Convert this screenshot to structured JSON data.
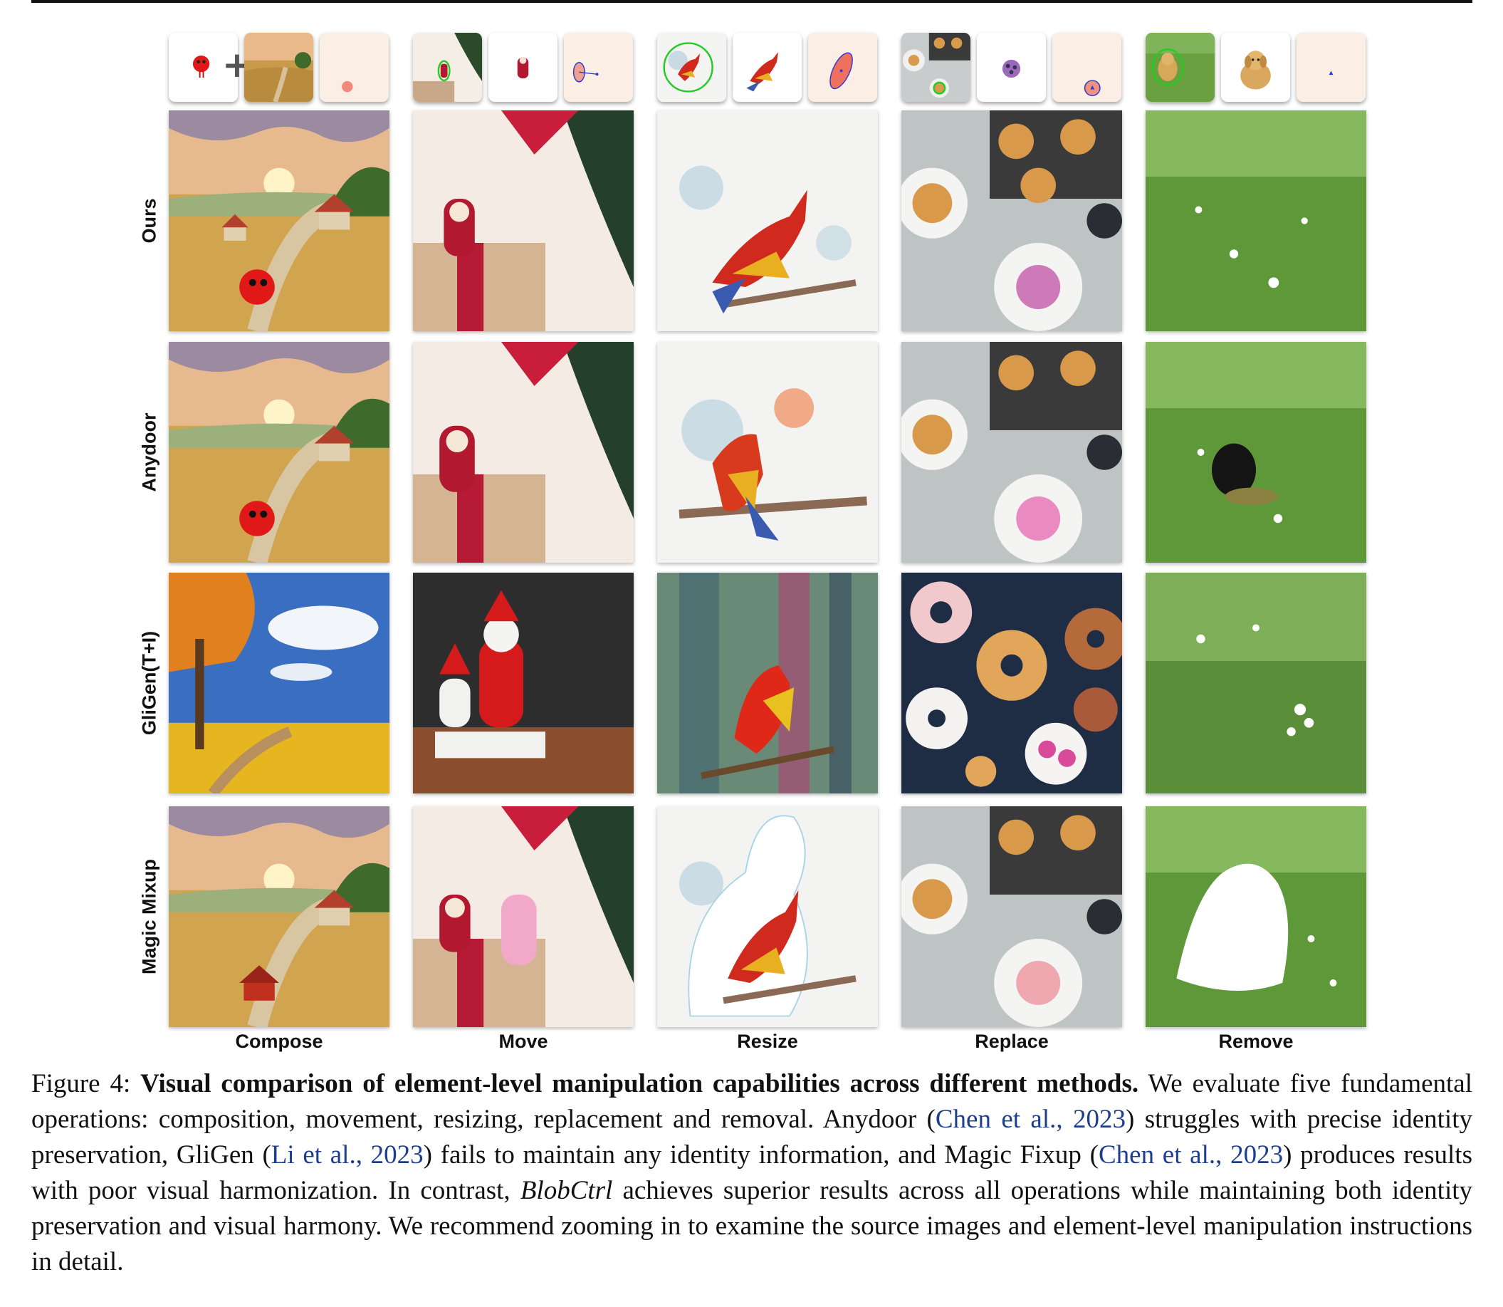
{
  "figure": {
    "row_labels": [
      "Ours",
      "Anydoor",
      "GliGen(T+I)",
      "Magic Mixup"
    ],
    "column_labels": [
      "Compose",
      "Move",
      "Resize",
      "Replace",
      "Remove"
    ],
    "compose_plus": "+"
  },
  "caption": {
    "figure_label": "Figure 4:",
    "bold_title": "Visual comparison of element-level manipulation capabilities across different methods.",
    "text_1": "We evaluate five fundamental operations: composition, movement, resizing, replacement and removal. Anydoor (",
    "cite_1": "Chen et al., 2023",
    "text_2": ") struggles with precise identity preservation, GliGen (",
    "cite_2": "Li et al., 2023",
    "text_3": ") fails to maintain any identity information, and Magic Fixup (",
    "cite_3": "Chen et al., 2023",
    "text_4": ") produces results with poor visual harmonization. In contrast, ",
    "method_name": "BlobCtrl",
    "text_5": " achieves superior results across all operations while maintaining both identity preservation and visual harmony. We recommend zooming in to examine the source images and element-level manipulation instructions in detail."
  },
  "colors": {
    "citation": "#1d3e8f",
    "text": "#111111",
    "mask_background": "#fbeee4",
    "blob_outline": "#2a3bd0",
    "selection_outline": "#22cc22"
  }
}
